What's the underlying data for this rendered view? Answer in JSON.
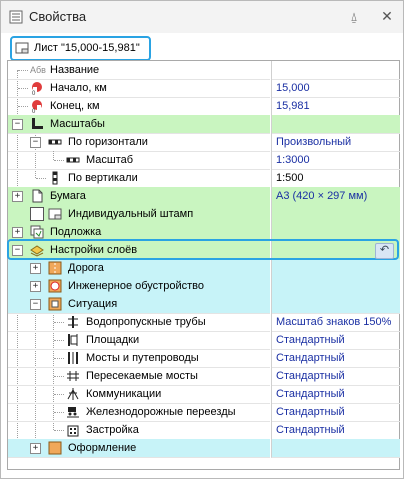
{
  "window": {
    "title": "Свойства",
    "pin_glyph": "⍙",
    "close_glyph": "✕"
  },
  "sheet": {
    "label": "Лист \"15,000-15,981\""
  },
  "rows": [
    {
      "label": "Название",
      "value": "",
      "prefix": "Абв"
    },
    {
      "label": "Начало, км",
      "value": "15,000"
    },
    {
      "label": "Конец, км",
      "value": "15,981"
    },
    {
      "label": "Масштабы",
      "value": ""
    },
    {
      "label": "По горизонтали",
      "value": "Произвольный"
    },
    {
      "label": "Масштаб",
      "value": "1:3000"
    },
    {
      "label": "По вертикали",
      "value": "1:500"
    },
    {
      "label": "Бумага",
      "value": "A3 (420 × 297 мм)"
    },
    {
      "label": "Индивидуальный штамп",
      "value": ""
    },
    {
      "label": "Подложка",
      "value": ""
    },
    {
      "label": "Настройки слоёв",
      "value": ""
    },
    {
      "label": "Дорога",
      "value": ""
    },
    {
      "label": "Инженерное обустройство",
      "value": ""
    },
    {
      "label": "Ситуация",
      "value": ""
    },
    {
      "label": "Водопропускные трубы",
      "value": "Масштаб знаков 150%"
    },
    {
      "label": "Площадки",
      "value": "Стандартный"
    },
    {
      "label": "Мосты и путепроводы",
      "value": "Стандартный"
    },
    {
      "label": "Пересекаемые мосты",
      "value": "Стандартный"
    },
    {
      "label": "Коммуникации",
      "value": "Стандартный"
    },
    {
      "label": "Железнодорожные переезды",
      "value": "Стандартный"
    },
    {
      "label": "Застройка",
      "value": "Стандартный"
    },
    {
      "label": "Оформление",
      "value": ""
    }
  ],
  "expanders": {
    "minus": "−",
    "plus": "+"
  },
  "undo_glyph": "↶",
  "colors": {
    "group_green": "#c9f5c0",
    "group_cyan": "#c7f3f8",
    "value_blue": "#1a2fa3",
    "selection": "#2aa3e3"
  }
}
